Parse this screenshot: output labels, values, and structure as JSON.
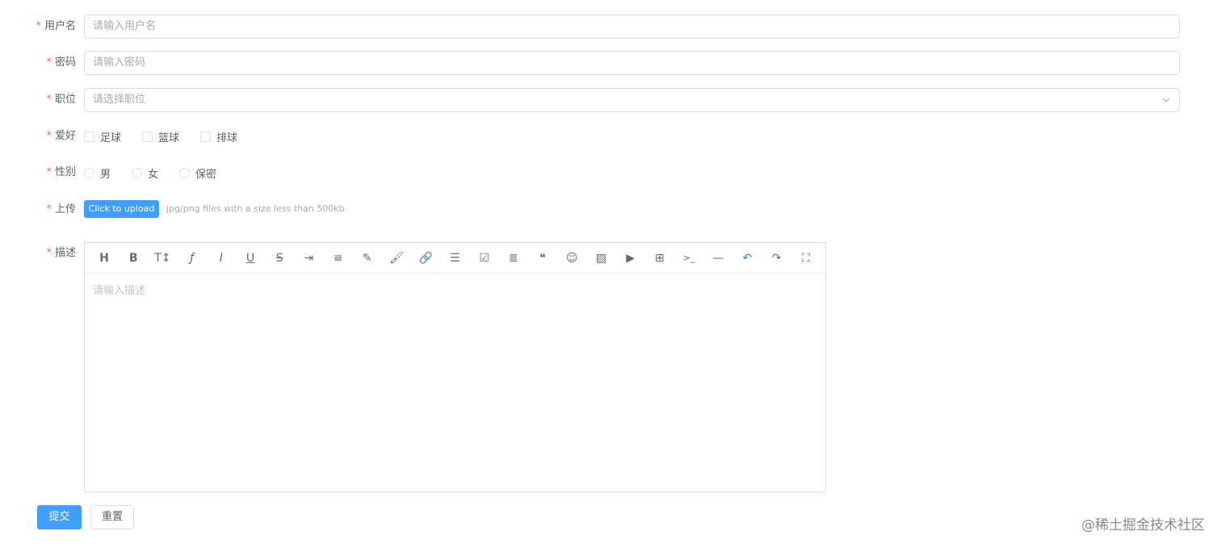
{
  "form": {
    "required_mark": "*",
    "username": {
      "label": "用户名",
      "placeholder": "请输入用户名"
    },
    "password": {
      "label": "密码",
      "placeholder": "请输入密码"
    },
    "position": {
      "label": "职位",
      "placeholder": "请选择职位"
    },
    "hobbies": {
      "label": "爱好",
      "options": [
        "足球",
        "篮球",
        "排球"
      ]
    },
    "gender": {
      "label": "性别",
      "options": [
        "男",
        "女",
        "保密"
      ]
    },
    "upload": {
      "label": "上传",
      "button": "Click to upload",
      "tip": "jpg/png files with a size less than 500kb"
    },
    "description": {
      "label": "描述",
      "placeholder": "请输入描述"
    }
  },
  "editor": {
    "toolbar": [
      {
        "icon": "header-icon",
        "glyph": "H"
      },
      {
        "icon": "bold-icon",
        "glyph": "B"
      },
      {
        "icon": "font-size-icon",
        "glyph": "T↕"
      },
      {
        "icon": "font-family-icon",
        "glyph": "ƒ"
      },
      {
        "icon": "italic-icon",
        "glyph": "I"
      },
      {
        "icon": "underline-icon",
        "glyph": "U"
      },
      {
        "icon": "strikethrough-icon",
        "glyph": "S"
      },
      {
        "icon": "indent-icon",
        "glyph": "⇥"
      },
      {
        "icon": "line-height-icon",
        "glyph": "≡"
      },
      {
        "icon": "font-color-icon",
        "glyph": "✎"
      },
      {
        "icon": "background-color-icon",
        "glyph": "🖌"
      },
      {
        "icon": "link-icon",
        "glyph": "🔗"
      },
      {
        "icon": "list-icon",
        "glyph": "☰"
      },
      {
        "icon": "todo-icon",
        "glyph": "☑"
      },
      {
        "icon": "justify-icon",
        "glyph": "≣"
      },
      {
        "icon": "quote-icon",
        "glyph": "❝"
      },
      {
        "icon": "emoticon-icon",
        "glyph": "☺"
      },
      {
        "icon": "image-icon",
        "glyph": "▨"
      },
      {
        "icon": "video-icon",
        "glyph": "▶"
      },
      {
        "icon": "table-icon",
        "glyph": "⊞"
      },
      {
        "icon": "code-icon",
        "glyph": ">_"
      },
      {
        "icon": "divider-icon",
        "glyph": "—"
      },
      {
        "icon": "undo-icon",
        "glyph": "↶"
      },
      {
        "icon": "redo-icon",
        "glyph": "↷"
      },
      {
        "icon": "fullscreen-icon",
        "glyph": "⛶"
      }
    ]
  },
  "actions": {
    "submit": "提交",
    "reset": "重置"
  },
  "watermark": "@稀土掘金技术社区",
  "colors": {
    "primary": "#409eff",
    "required": "#f56c6c",
    "border": "#dcdfe6",
    "undo_active": "#1e88e5"
  }
}
